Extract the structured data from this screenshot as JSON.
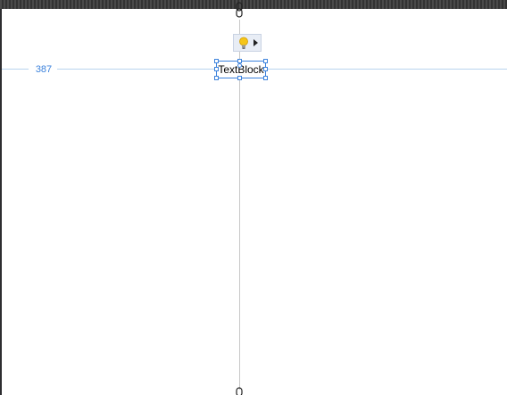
{
  "designer": {
    "margin_label": "387",
    "element_text": "TextBlock",
    "top_anchor_icon": "anchor-lock-icon",
    "bottom_anchor_icon": "anchor-lock-icon",
    "smart_tag_icon": "lightbulb-icon",
    "smart_tag_arrow_icon": "caret-right-icon"
  },
  "colors": {
    "selection": "#3c82dc",
    "guide": "#b9d3ee",
    "bulb": "#f5c518"
  }
}
